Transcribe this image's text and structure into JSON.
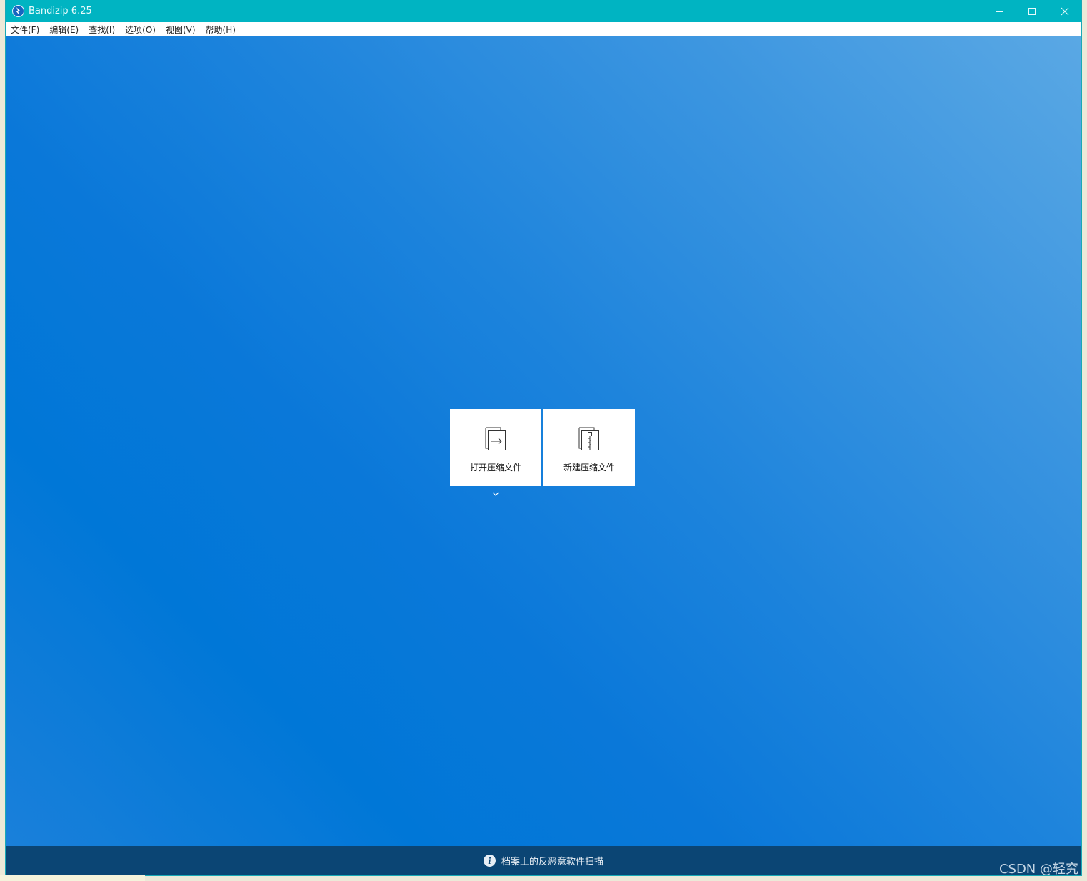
{
  "window": {
    "title": "Bandizip 6.25",
    "accent_color": "#00b4c2"
  },
  "menu": {
    "items": [
      {
        "label": "文件(F)"
      },
      {
        "label": "编辑(E)"
      },
      {
        "label": "查找(I)"
      },
      {
        "label": "选项(O)"
      },
      {
        "label": "视图(V)"
      },
      {
        "label": "帮助(H)"
      }
    ]
  },
  "tiles": {
    "open": {
      "label": "打开压缩文件",
      "icon": "open-archive-icon"
    },
    "new": {
      "label": "新建压缩文件",
      "icon": "new-archive-icon"
    }
  },
  "status": {
    "text": "档案上的反恶意软件扫描",
    "icon": "info-icon",
    "background": "#0b4574"
  },
  "watermark": {
    "text": "CSDN @轻究"
  }
}
